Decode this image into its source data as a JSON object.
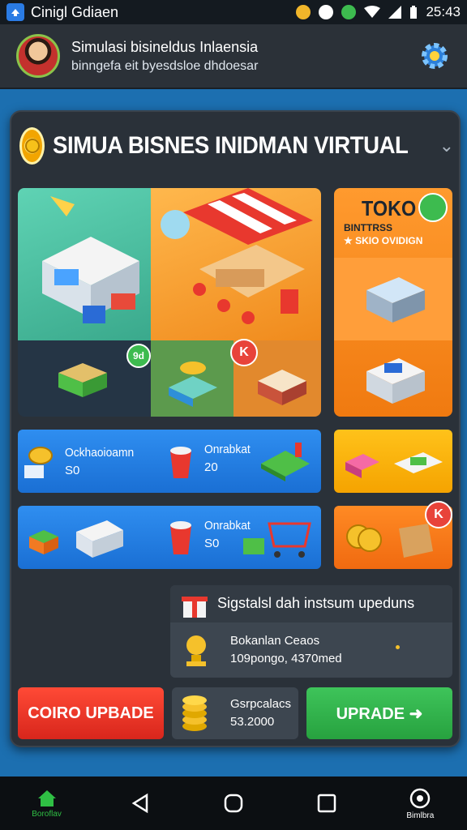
{
  "status_bar": {
    "app_icon_letter": "",
    "title": "Cinigl Gdiaen",
    "time": "25:43"
  },
  "header": {
    "title": "Simulasi bisineldus Inlaensia",
    "subtitle": "binngefa eit byesdsloe dhdoesar"
  },
  "panel": {
    "title": "SIMUA BISNES INIDMAN VIRTUAL"
  },
  "scene": {
    "badge_green": "9d",
    "badge_red": "K"
  },
  "toko": {
    "title": "TOKO",
    "sub1": "BINTTRSS",
    "sub2": "★ SKIO OVIDIGN"
  },
  "row1": {
    "item1_label": "Ockhaoioamn",
    "item1_value": "S0",
    "item2_label": "Onrabkat",
    "item2_value": "20"
  },
  "row2": {
    "item1_label": "Onrabkat",
    "item1_value": "S0"
  },
  "row2_side": {
    "badge": "K"
  },
  "info": {
    "title": "Sigstalsl dah instsum upeduns",
    "line1": "Bokanlan Ceaos",
    "line2": "109pongo, 4370med"
  },
  "buttons": {
    "left": "COIRO UPBADE",
    "right": "UPRADE ➜"
  },
  "coin_box": {
    "label": "Gsrpcalacs",
    "value": "53.2000"
  },
  "nav": {
    "home_label": "Boroflav",
    "right_label": "Bimlbra"
  }
}
